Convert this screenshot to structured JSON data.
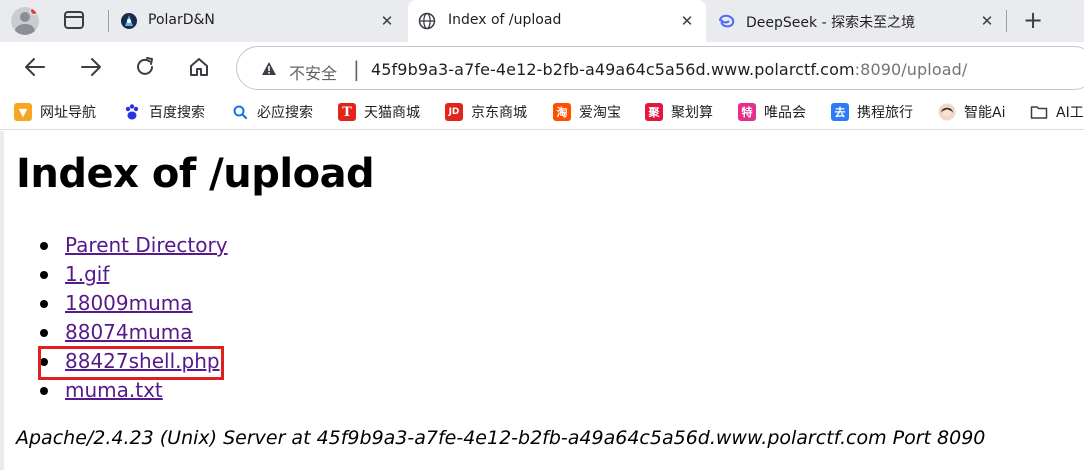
{
  "browser": {
    "tabs": [
      {
        "title": "PolarD&N",
        "active": false
      },
      {
        "title": "Index of /upload",
        "active": true
      },
      {
        "title": "DeepSeek - 探索未至之境",
        "active": false
      }
    ],
    "new_tab_symbol": "+",
    "close_symbol": "✕",
    "omnibox": {
      "security_label": "不安全",
      "url_host": "45f9b9a3-a7fe-4e12-b2fb-a49a64c5a56d.www.polarctf.com",
      "url_rest": ":8090/upload/"
    },
    "bookmarks": [
      {
        "label": "网址导航",
        "icon": "hao123-icon",
        "color": "#f5a623",
        "glyph": "▼"
      },
      {
        "label": "百度搜索",
        "icon": "baidu-paw-icon",
        "color": "#2932e1",
        "glyph": "🐾"
      },
      {
        "label": "必应搜索",
        "icon": "bing-search-icon",
        "color": "#ffffff",
        "glyph": "🔍"
      },
      {
        "label": "天猫商城",
        "icon": "tmall-icon",
        "color": "#e1251b",
        "glyph": "T"
      },
      {
        "label": "京东商城",
        "icon": "jd-icon",
        "color": "#e1251b",
        "glyph": "JD"
      },
      {
        "label": "爱淘宝",
        "icon": "taobao-icon",
        "color": "#ff5000",
        "glyph": "淘"
      },
      {
        "label": "聚划算",
        "icon": "juhuasuan-icon",
        "color": "#e0173f",
        "glyph": "聚"
      },
      {
        "label": "唯品会",
        "icon": "vip-icon",
        "color": "#e4308b",
        "glyph": "特"
      },
      {
        "label": "携程旅行",
        "icon": "ctrip-icon",
        "color": "#2f7bf5",
        "glyph": "去"
      },
      {
        "label": "智能Ai",
        "icon": "ai-avatar-icon",
        "color": "#f0c9b5",
        "glyph": ""
      },
      {
        "label": "AI工",
        "icon": "folder-icon",
        "color": "#ffffff",
        "glyph": ""
      }
    ]
  },
  "page": {
    "heading": "Index of /upload",
    "entries": [
      {
        "label": "Parent Directory"
      },
      {
        "label": "1.gif"
      },
      {
        "label": "18009muma"
      },
      {
        "label": "88074muma"
      },
      {
        "label": "88427shell.php"
      },
      {
        "label": "muma.txt"
      }
    ],
    "highlighted_entry": "88427shell.php",
    "highlight_color": "#e02020",
    "link_color": "#551a8b",
    "server_signature": "Apache/2.4.23 (Unix) Server at 45f9b9a3-a7fe-4e12-b2fb-a49a64c5a56d.www.polarctf.com Port 8090"
  }
}
